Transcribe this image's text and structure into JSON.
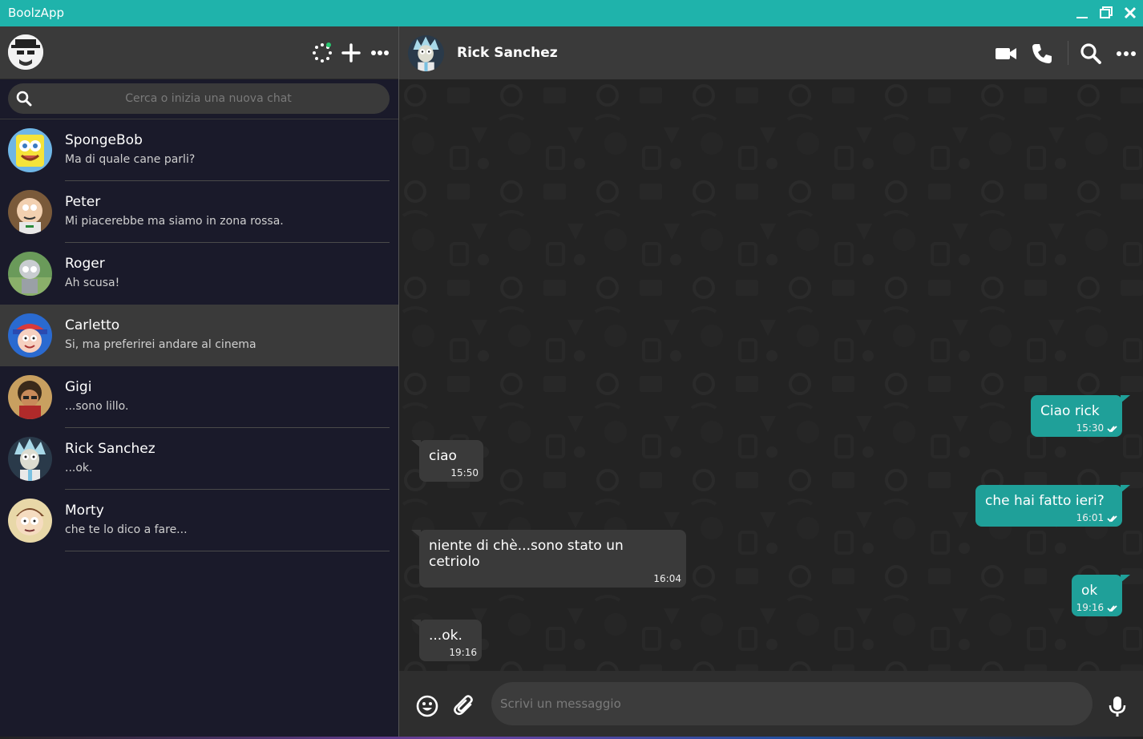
{
  "app": {
    "title": "BoolzApp"
  },
  "colors": {
    "accent": "#1fb3ab",
    "sent_bubble": "#1fa099",
    "recv_bubble": "#3a3a3a"
  },
  "sidebar": {
    "search": {
      "placeholder": "Cerca o inizia una nuova chat",
      "value": ""
    },
    "chats": [
      {
        "name": "SpongeBob",
        "last": "Ma di quale cane parli?"
      },
      {
        "name": "Peter",
        "last": "Mi piacerebbe ma siamo in zona rossa."
      },
      {
        "name": "Roger",
        "last": "Ah scusa!"
      },
      {
        "name": "Carletto",
        "last": "Si, ma preferirei andare al cinema",
        "active": true
      },
      {
        "name": "Gigi",
        "last": "...sono lillo."
      },
      {
        "name": "Rick Sanchez",
        "last": "...ok."
      },
      {
        "name": "Morty",
        "last": "che te lo dico a fare..."
      }
    ]
  },
  "chat": {
    "contact_name": "Rick Sanchez",
    "messages": [
      {
        "text": "Ciao rick",
        "time": "15:30",
        "type": "sent"
      },
      {
        "text": "ciao",
        "time": "15:50",
        "type": "received"
      },
      {
        "text": "che hai fatto ieri?",
        "time": "16:01",
        "type": "sent"
      },
      {
        "text": "niente di chè...sono stato un cetriolo",
        "time": "16:04",
        "type": "received"
      },
      {
        "text": "ok",
        "time": "19:16",
        "type": "sent"
      },
      {
        "text": "...ok.",
        "time": "19:16",
        "type": "received"
      }
    ],
    "composer": {
      "placeholder": "Scrivi un messaggio",
      "value": ""
    }
  }
}
